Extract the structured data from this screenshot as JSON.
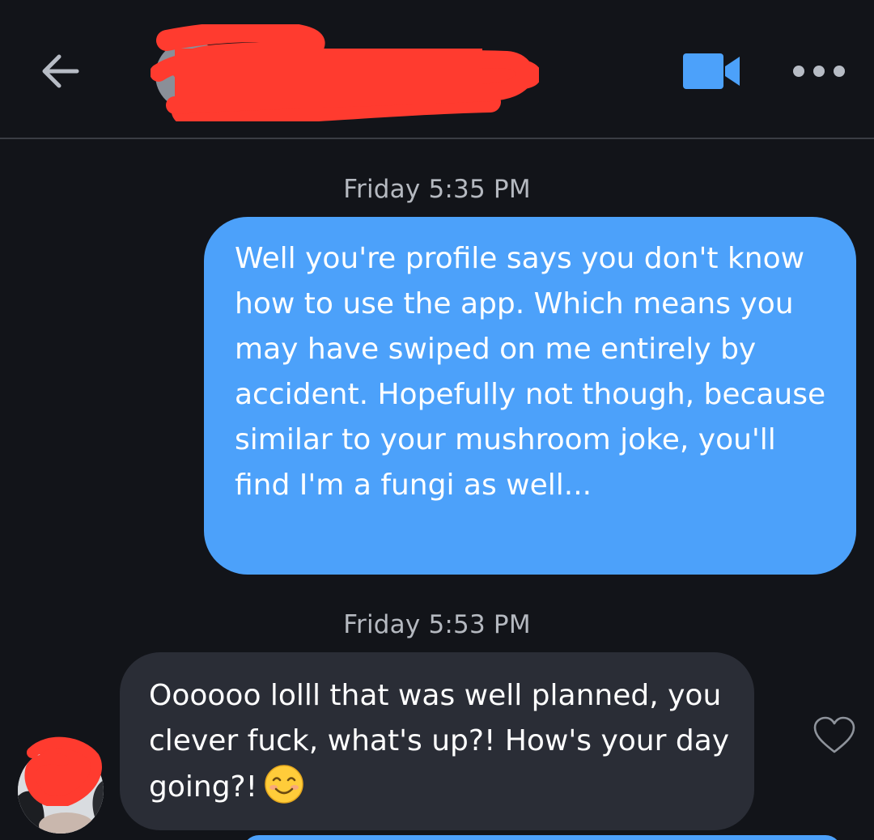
{
  "header": {
    "back_icon": "arrow-left-icon",
    "video_icon": "video-camera-icon",
    "more_icon": "more-horizontal-icon",
    "accent_color": "#4ca1fa"
  },
  "messages": [
    {
      "timestamp_day": "Friday",
      "timestamp_time": "5:35 PM",
      "direction": "outgoing",
      "text": "Well you're profile says you don't know how to use the app. Which means you may have swiped on me entirely by accident. Hopefully not though, because similar to your mushroom joke, you'll find I'm a fungi as well..."
    },
    {
      "timestamp_day": "Friday",
      "timestamp_time": "5:53 PM",
      "direction": "incoming",
      "text": "Oooooo lolll that was well planned, you clever fuck, what's up?! How's your day going?!",
      "emoji": "smiling-face-icon",
      "like_icon": "heart-outline-icon"
    }
  ],
  "colors": {
    "background": "#121419",
    "outgoing_bubble": "#4ca1fa",
    "incoming_bubble": "#2a2d36",
    "timestamp_text": "#b5b9c0",
    "redaction": "#ff3b2f"
  }
}
